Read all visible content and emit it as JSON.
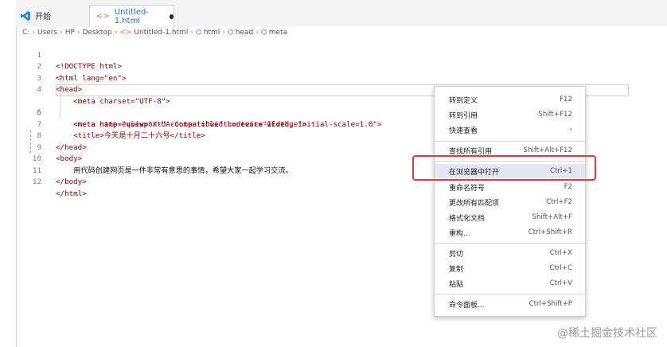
{
  "tabs": {
    "start_label": "开始",
    "file_label": "Untitled-1.html"
  },
  "breadcrumb": {
    "path": [
      "C:",
      "Users",
      "HP",
      "Desktop",
      "Untitled-1.html",
      "html",
      "head",
      "meta"
    ]
  },
  "editor": {
    "lines": [
      {
        "num": "1",
        "code": "<!DOCTYPE html>"
      },
      {
        "num": "2",
        "code": "<html lang=\"en\">"
      },
      {
        "num": "3",
        "code": "<head>"
      },
      {
        "num": "4",
        "code": "    <meta charset=\"UTF-8\">"
      },
      {
        "num": "5",
        "code": "    <meta http-equiv=\"X-UA-Compatible\" content=\"IE=edge\">"
      },
      {
        "num": "6",
        "code": "    <meta name=\"viewport\" content=\"width=device-width, initial-scale=1.0\">"
      },
      {
        "num": "7",
        "code": "    <title>今天是十月二十六号</title>"
      },
      {
        "num": "8",
        "code": "</head>"
      },
      {
        "num": "9",
        "code": "<body>"
      },
      {
        "num": "10",
        "code": "    用代码创建网页是一件非常有意思的事情，希望大家一起学习交流。"
      },
      {
        "num": "11",
        "code": "</body>"
      },
      {
        "num": "12",
        "code": "</html>"
      }
    ]
  },
  "context_menu": {
    "items": [
      {
        "label": "转到定义",
        "shortcut": "F12"
      },
      {
        "label": "转到引用",
        "shortcut": "Shift+F12"
      },
      {
        "label": "快速查看",
        "shortcut": "›"
      },
      {
        "label": "查找所有引用",
        "shortcut": "Shift+Alt+F12"
      },
      {
        "label": "在浏览器中打开",
        "shortcut": "Ctrl+1"
      },
      {
        "label": "重命名符号",
        "shortcut": "F2"
      },
      {
        "label": "更改所有匹配项",
        "shortcut": "Ctrl+F2"
      },
      {
        "label": "格式化文档",
        "shortcut": "Shift+Alt+F"
      },
      {
        "label": "重构...",
        "shortcut": "Ctrl+Shift+R"
      },
      {
        "label": "剪切",
        "shortcut": "Ctrl+X"
      },
      {
        "label": "复制",
        "shortcut": "Ctrl+C"
      },
      {
        "label": "粘贴",
        "shortcut": "Ctrl+V"
      },
      {
        "label": "命令面板...",
        "shortcut": "Ctrl+Shift+P"
      }
    ]
  },
  "watermark": {
    "text": "@稀土掘金技术社区"
  },
  "colors": {
    "highlight_box": "#e53935",
    "menu_hover": "#e4e6f1",
    "accent": "#1e6fbf"
  }
}
